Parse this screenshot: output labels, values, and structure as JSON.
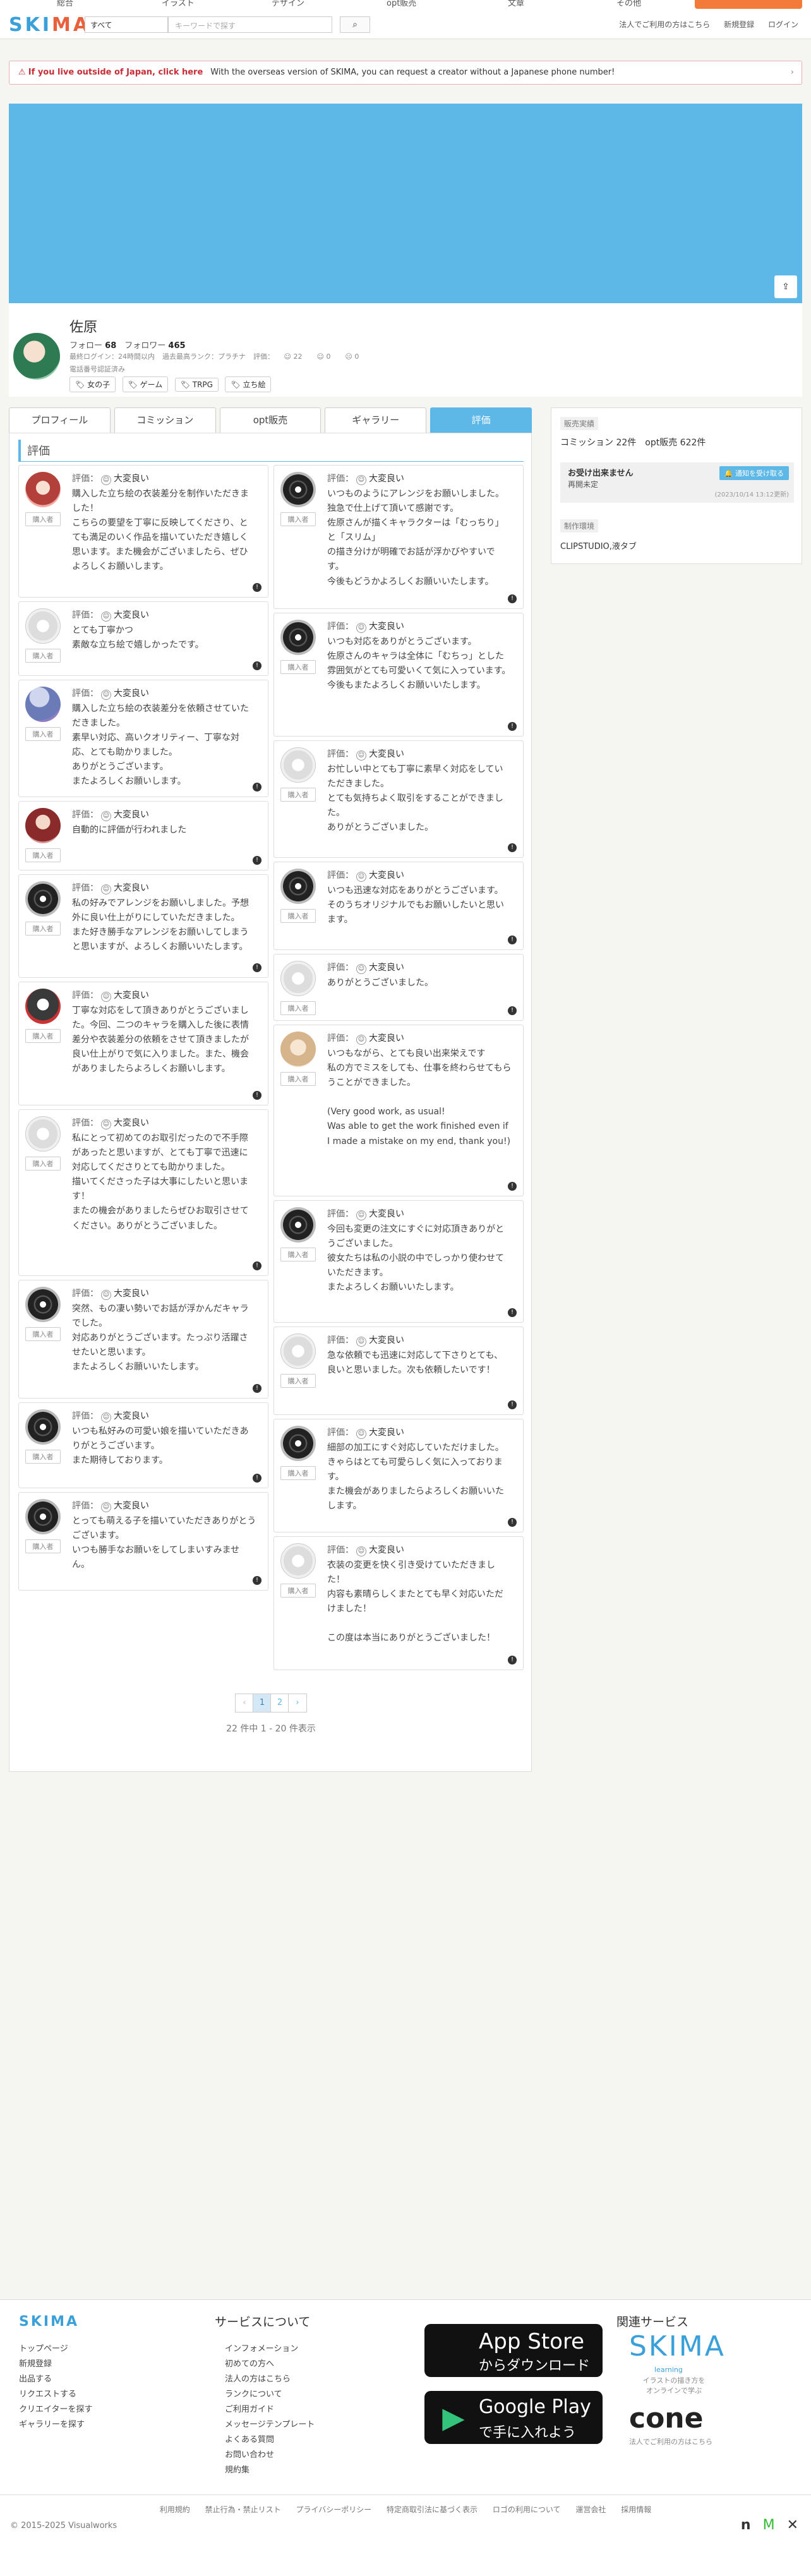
{
  "topnav": [
    "総合",
    "イラスト",
    "デザイン",
    "opt販売",
    "文章",
    "その他"
  ],
  "header": {
    "logo_a": "SKI",
    "logo_b": "MA",
    "search_category": "すべて",
    "search_placeholder": "キーワードで探す",
    "links": [
      "法人でご利用の方はこちら",
      "新規登録",
      "ログイン"
    ]
  },
  "notice": {
    "strong": "If you live outside of Japan, click here",
    "text": "With the overseas version of SKIMA, you can request a creator without a Japanese phone number!"
  },
  "profile": {
    "name": "佐原",
    "follow_label": "フォロー",
    "follow": "68",
    "follower_label": "フォロワー",
    "follower": "465",
    "meta": [
      "最終ログイン：24時間以内",
      "過去最高ランク：プラチナ",
      "評価：",
      "22",
      "0",
      "0"
    ],
    "phone": "電話番号認証済み",
    "tags": [
      "女の子",
      "ゲーム",
      "TRPG",
      "立ち絵"
    ]
  },
  "tabs": [
    "プロフィール",
    "コミッション",
    "opt販売",
    "ギャラリー",
    "評価"
  ],
  "section_title": "評価",
  "rating_label": "評価：",
  "rating_value": "大変良い",
  "buyer_label": "購入者",
  "reviews_left": [
    {
      "avatar": "anime1",
      "text": "購入した立ち絵の衣装差分を制作いただきました！\nこちらの要望を丁寧に反映してくださり、とても満足のいく作品を描いていただき嬉しく思います。また機会がございましたら、ぜひよろしくお願いします。"
    },
    {
      "avatar": "pale",
      "text": "とても丁寧かつ\n素敵な立ち絵で嬉しかったです。"
    },
    {
      "avatar": "blue",
      "text": "購入した立ち絵の衣装差分を依頼させていただきました。\n素早い対応、高いクオリティー、丁寧な対応、とても助かりました。\nありがとうございます。\nまたよろしくお願いします。"
    },
    {
      "avatar": "red",
      "text": "自動的に評価が行われました"
    },
    {
      "avatar": "dark",
      "text": "私の好みでアレンジをお願いしました。予想外に良い仕上がりにしていただきました。\nまた好き勝手なアレンジをお願いしてしまうと思いますが、よろしくお願いいたします。"
    },
    {
      "avatar": "wolf",
      "text": "丁寧な対応をして頂きありがとうございました。今回、二つのキャラを購入した後に表情差分や衣装差分の依頼をさせて頂きましたが良い仕上がりで気に入りました。また、機会がありましたらよろしくお願いします。"
    },
    {
      "avatar": "pale",
      "text": "私にとって初めてのお取引だったので不手際があったと思いますが、とても丁寧で迅速に対応してくださりとても助かりました。\n描いてくださった子は大事にしたいと思います！\nまたの機会がありましたらぜひお取引させてください。ありがとうございました。"
    },
    {
      "avatar": "dark",
      "text": "突然、もの凄い勢いでお話が浮かんだキャラでした。\n対応ありがとうございます。たっぷり活躍させたいと思います。\nまたよろしくお願いいたします。"
    },
    {
      "avatar": "dark",
      "text": "いつも私好みの可愛い娘を描いていただきありがとうございます。\nまた期待しております。"
    },
    {
      "avatar": "dark",
      "text": "とっても萌える子を描いていただきありがとうございます。\nいつも勝手なお願いをしてしまいすみません。"
    }
  ],
  "reviews_right": [
    {
      "avatar": "dark",
      "text": "いつものようにアレンジをお願いしました。\n独急で仕上げて頂いて感謝です。\n佐原さんが描くキャラクターは「むっちり」と「スリム」\nの描き分けが明確でお話が浮かびやすいです。\n今後もどうかよろしくお願いいたします。"
    },
    {
      "avatar": "dark",
      "text": "いつも対応をありがとうございます。\n佐原さんのキャラは全体に「むちっ」とした雰囲気がとても可愛いくて気に入っています。\n今後もまたよろしくお願いいたします。"
    },
    {
      "avatar": "pale",
      "text": "お忙しい中とても丁寧に素早く対応をしていただきました。\nとても気持ちよく取引をすることができました。\nありがとうございました。"
    },
    {
      "avatar": "dark",
      "text": "いつも迅速な対応をありがとうございます。\nそのうちオリジナルでもお願いしたいと思います。"
    },
    {
      "avatar": "pale",
      "text": "ありがとうございました。"
    },
    {
      "avatar": "beige",
      "text": "いつもながら、とても良い出来栄えです\n私の方でミスをしても、仕事を終わらせてもらうことができました。\n\n(Very good work, as usual!\nWas able to get the work finished even if I made a mistake on my end, thank you!)"
    },
    {
      "avatar": "dark",
      "text": "今回も変更の注文にすぐに対応頂きありがとうございました。\n彼女たちは私の小説の中でしっかり使わせていただきます。\nまたよろしくお願いいたします。"
    },
    {
      "avatar": "pale",
      "text": "急な依頼でも迅速に対応して下さりとても、良いと思いました。次も依頼したいです！"
    },
    {
      "avatar": "dark",
      "text": "細部の加工にすぐ対応していただけました。\nきゃらはとても可愛らしく気に入っております。\nまた機会がありましたらよろしくお願いいたします。"
    },
    {
      "avatar": "pale",
      "text": "衣装の変更を快く引き受けていただきました！\n内容も素晴らしくまたとても早く対応いただけました！\n\nこの度は本当にありがとうございました！"
    }
  ],
  "pager": {
    "prev": "‹",
    "pages": [
      "1",
      "2"
    ],
    "next": "›",
    "count": "22 件中 1 - 20 件表示"
  },
  "side": {
    "label1": "販売実績",
    "stats": "コミッション 22件　opt販売 622件",
    "box_title": "お受け出来ません",
    "box_sub": "再開未定",
    "box_btn": "通知を受け取る",
    "box_date": "(2023/10/14 13:12更新)",
    "label2": "制作環境",
    "env": "CLIPSTUDIO,液タブ"
  },
  "footer": {
    "logo": "SKIMA",
    "links1": [
      "トップページ",
      "新規登録",
      "出品する",
      "リクエストする",
      "クリエイターを探す",
      "ギャラリーを探す"
    ],
    "about_title": "サービスについて",
    "links2": [
      "インフォメーション",
      "初めての方へ",
      "法人の方はこちら",
      "ランクについて",
      "ご利用ガイド",
      "メッセージテンプレート",
      "よくある質問",
      "お問い合わせ",
      "規約集"
    ],
    "appstore_a": "App Store",
    "appstore_b": "からダウンロード",
    "gplay_a": "Google Play",
    "gplay_b": "で手に入れよう",
    "related_title": "関連サービス",
    "rel_skima": "SKIMA",
    "rel_learning": "learning",
    "rel_sub": "イラストの描き方を\nオンラインで学ぶ",
    "rel_cone": "cone",
    "rel_cone_sub": "法人でご利用の方はこちら",
    "bottom_links": [
      "利用規約",
      "禁止行為・禁止リスト",
      "プライバシーポリシー",
      "特定商取引法に基づく表示",
      "ロゴの利用について",
      "運営会社",
      "採用情報"
    ],
    "copyright": "© 2015-2025 Visualworks"
  }
}
